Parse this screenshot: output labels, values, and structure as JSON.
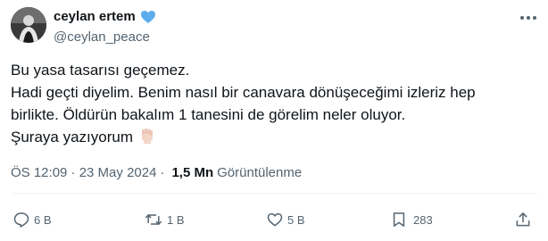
{
  "author": {
    "display_name": "ceylan ertem",
    "handle": "@ceylan_peace"
  },
  "tweet": {
    "lines": [
      "Bu yasa tasarısı geçemez.",
      "Hadi geçti diyelim. Benim nasıl bir canavara dönüşeceğimi izleriz hep",
      "birlikte. Öldürün bakalım 1 tanesini de görelim neler oluyor.",
      "Şuraya yazıyorum"
    ]
  },
  "meta": {
    "timestamp": "ÖS 12:09 · 23 May 2024",
    "separator": "·",
    "views_count": "1,5 Mn",
    "views_label": "Görüntülenme"
  },
  "actions": {
    "replies": "6 B",
    "reposts": "1 B",
    "likes": "5 B",
    "bookmarks": "283"
  },
  "icons": [
    "blue-heart-icon",
    "more-icon",
    "raised-fist-icon",
    "reply-icon",
    "repost-icon",
    "like-icon",
    "bookmark-icon",
    "share-icon"
  ],
  "colors": {
    "text": "#0f1419",
    "secondary": "#536471",
    "heart": "#5dadec"
  }
}
